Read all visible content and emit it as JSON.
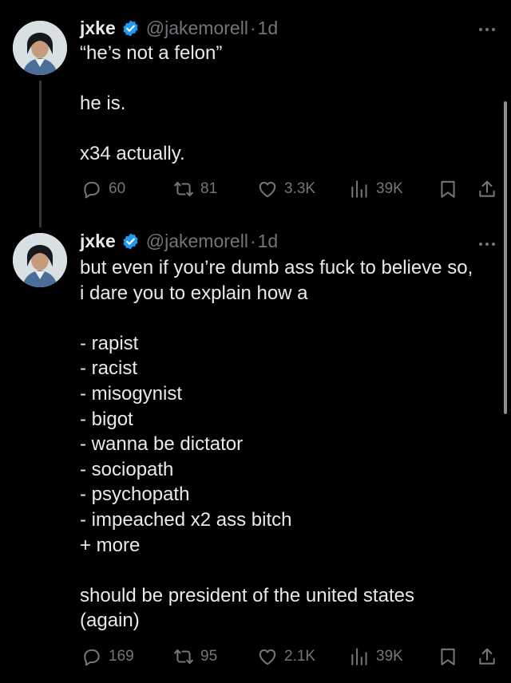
{
  "tweets": [
    {
      "author": {
        "display_name": "jxke",
        "handle": "@jakemorell",
        "verified": true,
        "avatar_icon": "profile-photo"
      },
      "separator": "·",
      "time": "1d",
      "lines": [
        "“he’s not a felon”",
        "",
        "he is.",
        "",
        "x34 actually."
      ],
      "stats": {
        "replies": "60",
        "reposts": "81",
        "likes": "3.3K",
        "views": "39K"
      }
    },
    {
      "author": {
        "display_name": "jxke",
        "handle": "@jakemorell",
        "verified": true,
        "avatar_icon": "profile-photo"
      },
      "separator": "·",
      "time": "1d",
      "lines": [
        "but even if you’re dumb ass fuck to believe so,",
        "i dare you to explain how a",
        "",
        "- rapist",
        "- racist",
        "- misogynist",
        "- bigot",
        "- wanna be dictator",
        "- sociopath",
        "- psychopath",
        "- impeached x2 ass bitch",
        "+ more",
        "",
        "should be president of the united states",
        "(again)"
      ],
      "stats": {
        "replies": "169",
        "reposts": "95",
        "likes": "2.1K",
        "views": "39K"
      }
    }
  ],
  "colors": {
    "background": "#000000",
    "text": "#e7e9ea",
    "secondary": "#71767b",
    "verified_badge": "#1d9bf0",
    "thread_line": "#333639"
  },
  "icons": {
    "more": "more-dots-icon",
    "reply": "reply-bubble-icon",
    "repost": "repost-arrows-icon",
    "like": "heart-icon",
    "views": "views-bar-icon",
    "bookmark": "bookmark-icon",
    "share": "share-icon",
    "verified": "verified-badge-icon"
  }
}
